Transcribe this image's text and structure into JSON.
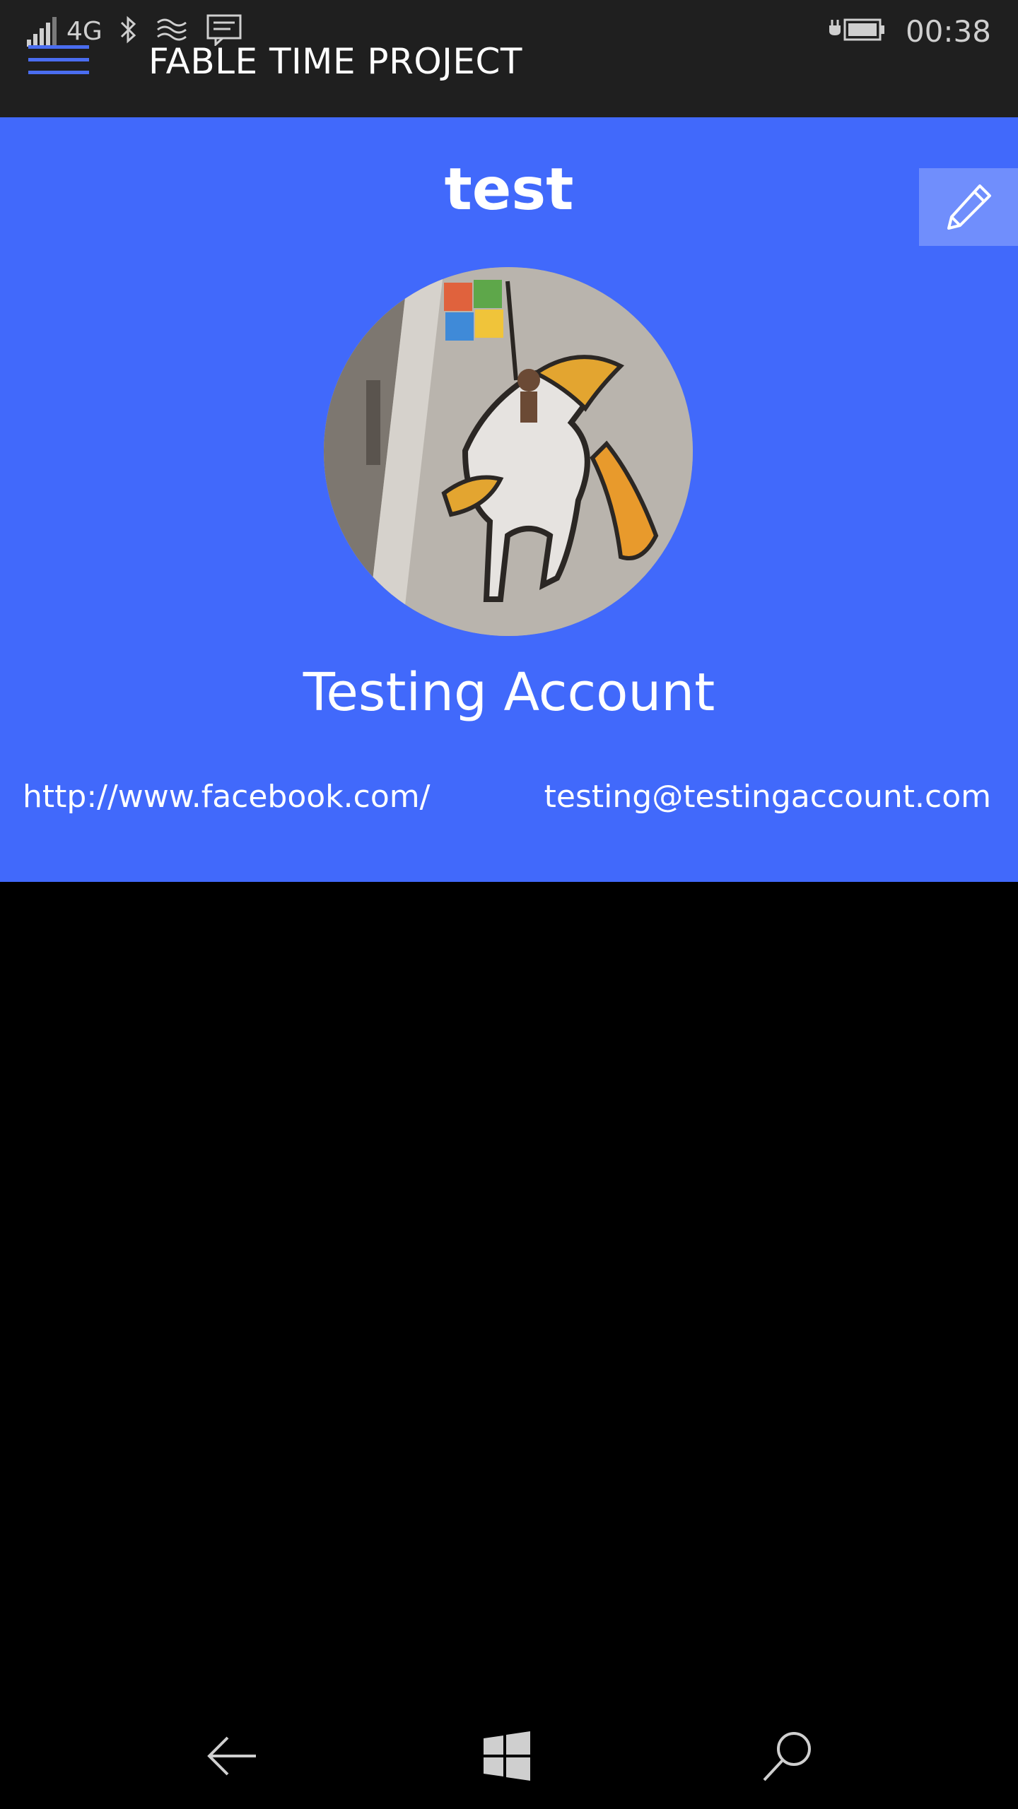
{
  "status_bar": {
    "network": "4G",
    "time": "00:38",
    "icons": [
      "signal-icon",
      "bluetooth-icon",
      "wifi-icon",
      "message-icon",
      "battery-charging-icon"
    ]
  },
  "header": {
    "menu_icon": "hamburger-icon",
    "app_title": "FABLE TIME PROJECT"
  },
  "profile": {
    "title": "test",
    "edit_icon": "pencil-icon",
    "avatar_icon": "profile-photo",
    "display_name": "Testing Account",
    "website": "http://www.facebook.com/",
    "email": "testing@testingaccount.com"
  },
  "navigation": {
    "back_icon": "back-arrow-icon",
    "home_icon": "windows-logo-icon",
    "search_icon": "search-icon"
  },
  "colors": {
    "accent": "#4169fb",
    "title_bar": "#1f1f1f",
    "background": "#000000",
    "hamburger": "#4a6df0"
  }
}
